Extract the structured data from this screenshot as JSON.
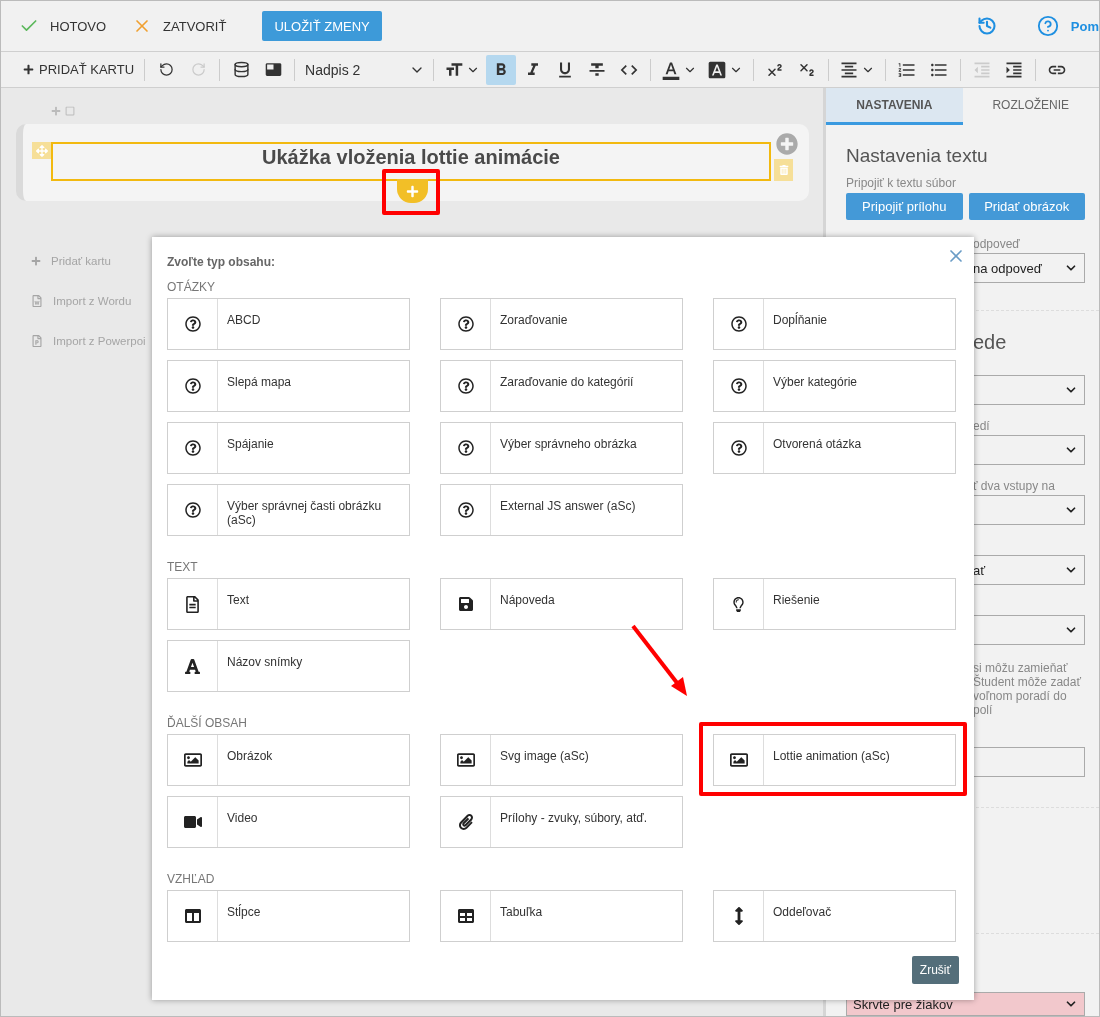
{
  "top_bar": {
    "done": "HOTOVO",
    "close": "ZATVORIŤ",
    "save": "ULOŽIŤ ZMENY",
    "help": "Pom"
  },
  "format_toolbar": {
    "add_card": "PRIDAŤ KARTU",
    "style_value": "Nadpis 2",
    "groups": [
      [
        {
          "kind": "undo",
          "disabled": false
        },
        {
          "kind": "redo",
          "disabled": true
        }
      ],
      [
        {
          "kind": "database"
        },
        {
          "kind": "panel"
        }
      ],
      [
        {
          "kind": "style-dropdown"
        }
      ],
      [
        {
          "kind": "font-size",
          "caret": true
        },
        {
          "kind": "bold",
          "active": true
        },
        {
          "kind": "italic",
          "active": false
        },
        {
          "kind": "underline",
          "active": false
        },
        {
          "kind": "strikethrough",
          "active": false
        },
        {
          "kind": "code",
          "active": false
        }
      ],
      [
        {
          "kind": "text-color",
          "caret": true
        },
        {
          "kind": "highlight",
          "caret": true
        }
      ],
      [
        {
          "kind": "superscript",
          "active": false
        },
        {
          "kind": "subscript",
          "active": false
        }
      ],
      [
        {
          "kind": "align",
          "caret": true
        }
      ],
      [
        {
          "kind": "ordered-list"
        },
        {
          "kind": "bullet-list"
        }
      ],
      [
        {
          "kind": "outdent",
          "disabled": true
        },
        {
          "kind": "indent",
          "disabled": false
        }
      ],
      [
        {
          "kind": "link"
        }
      ]
    ]
  },
  "editor": {
    "card_title": "Ukážka vloženia lottie animácie",
    "add_block_highlighted": true,
    "side_actions": [
      {
        "kind": "plus",
        "label": "Pridať kartu"
      },
      {
        "kind": "word",
        "label": "Import z Wordu"
      },
      {
        "kind": "powerpoint",
        "label": "Import z Powerpoi"
      }
    ]
  },
  "settings_panel": {
    "tabs": [
      {
        "label": "NASTAVENIA",
        "selected": true
      },
      {
        "label": "ROZLOŽENIE",
        "selected": false
      }
    ],
    "heading": "Nastavenia textu",
    "attach_label": "Pripojiť k textu súbor",
    "buttons": [
      "Pripojiť prílohu",
      "Pridať obrázok"
    ],
    "fields": [
      {
        "kind": "label",
        "text": "odpoveď"
      },
      {
        "kind": "select",
        "value": "na odpoveď"
      },
      {
        "kind": "divider"
      },
      {
        "kind": "heading",
        "text": "ede"
      },
      {
        "kind": "select"
      },
      {
        "kind": "label",
        "text": "edí"
      },
      {
        "kind": "select"
      },
      {
        "kind": "label",
        "text": "ť dva vstupy na"
      },
      {
        "kind": "select"
      },
      {
        "kind": "select",
        "value": "ať"
      },
      {
        "kind": "select"
      },
      {
        "kind": "note",
        "text": "si môžu zamieňať\nŠtudent môže zadať\nvoľnom poradí do polí"
      },
      {
        "kind": "input"
      },
      {
        "kind": "divider"
      },
      {
        "kind": "divider"
      },
      {
        "kind": "tinted_select",
        "value": "Skrvte pre žiakov"
      }
    ]
  },
  "dialog": {
    "title": "Zvoľte typ obsahu:",
    "cancel": "Zrušiť",
    "sections": [
      {
        "label": "OTÁZKY",
        "items": [
          {
            "kind": "question",
            "label": "ABCD",
            "highlighted": false
          },
          {
            "kind": "question",
            "label": "Zoraďovanie",
            "highlighted": false
          },
          {
            "kind": "question",
            "label": "Dopĺňanie",
            "highlighted": false
          },
          {
            "kind": "question",
            "label": "Slepá mapa",
            "highlighted": false
          },
          {
            "kind": "question",
            "label": "Zaraďovanie do kategórií",
            "highlighted": false
          },
          {
            "kind": "question",
            "label": "Výber kategórie",
            "highlighted": false
          },
          {
            "kind": "question",
            "label": "Spájanie",
            "highlighted": false
          },
          {
            "kind": "question",
            "label": "Výber správneho obrázka",
            "highlighted": false
          },
          {
            "kind": "question",
            "label": "Otvorená otázka",
            "highlighted": false
          },
          {
            "kind": "question",
            "label": "Výber správnej časti obrázku (aSc)",
            "highlighted": false
          },
          {
            "kind": "question",
            "label": "External JS answer (aSc)",
            "highlighted": false
          }
        ]
      },
      {
        "label": "TEXT",
        "items": [
          {
            "kind": "file",
            "label": "Text",
            "highlighted": false
          },
          {
            "kind": "save",
            "label": "Nápoveda",
            "highlighted": false
          },
          {
            "kind": "bulb",
            "label": "Riešenie",
            "highlighted": false
          },
          {
            "kind": "letter",
            "label": "Názov snímky",
            "highlighted": false
          }
        ]
      },
      {
        "label": "ĎALŠÍ OBSAH",
        "items": [
          {
            "kind": "image",
            "label": "Obrázok",
            "highlighted": false
          },
          {
            "kind": "image",
            "label": "Svg image (aSc)",
            "highlighted": false
          },
          {
            "kind": "image",
            "label": "Lottie animation (aSc)",
            "highlighted": true
          },
          {
            "kind": "video",
            "label": "Video",
            "highlighted": false
          },
          {
            "kind": "clip",
            "label": "Prílohy - zvuky, súbory, atď.",
            "highlighted": false
          }
        ]
      },
      {
        "label": "VZHĽAD",
        "items": [
          {
            "kind": "columns",
            "label": "Stĺpce",
            "highlighted": false
          },
          {
            "kind": "table",
            "label": "Tabuľka",
            "highlighted": false
          },
          {
            "kind": "vertical-arrows",
            "label": "Oddeľovač",
            "highlighted": false
          }
        ]
      }
    ]
  }
}
